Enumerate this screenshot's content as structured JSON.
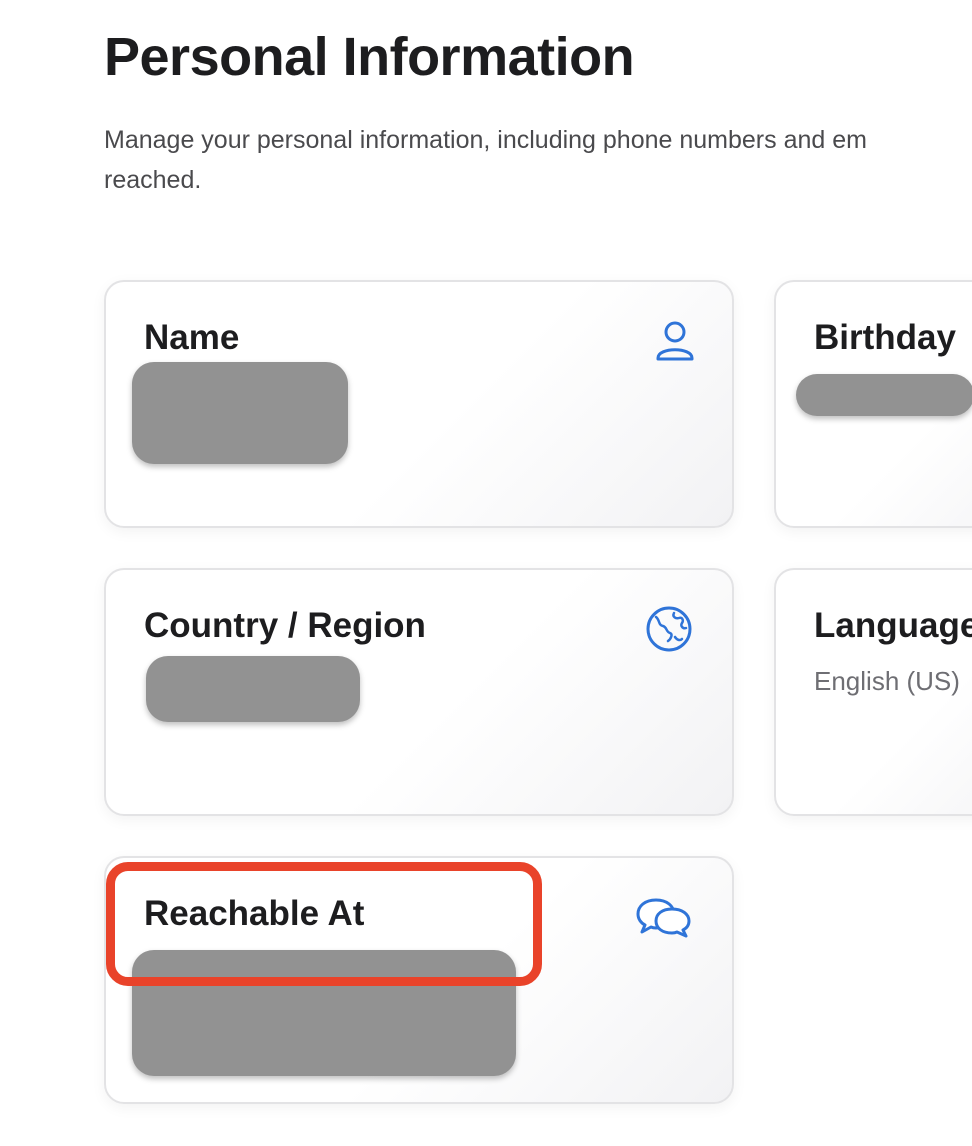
{
  "header": {
    "title": "Personal Information",
    "description_line1": "Manage your personal information, including phone numbers and em",
    "description_line2": "reached."
  },
  "cards": {
    "name": {
      "title": "Name",
      "icon": "person-icon"
    },
    "birthday": {
      "title": "Birthday"
    },
    "country": {
      "title": "Country / Region",
      "icon": "globe-icon"
    },
    "language": {
      "title": "Language",
      "value": "English (US)"
    },
    "reachable": {
      "title": "Reachable At",
      "icon": "chat-bubbles-icon"
    }
  },
  "colors": {
    "accent": "#2f74d8",
    "highlight": "#e9432a",
    "redaction": "#929292"
  }
}
